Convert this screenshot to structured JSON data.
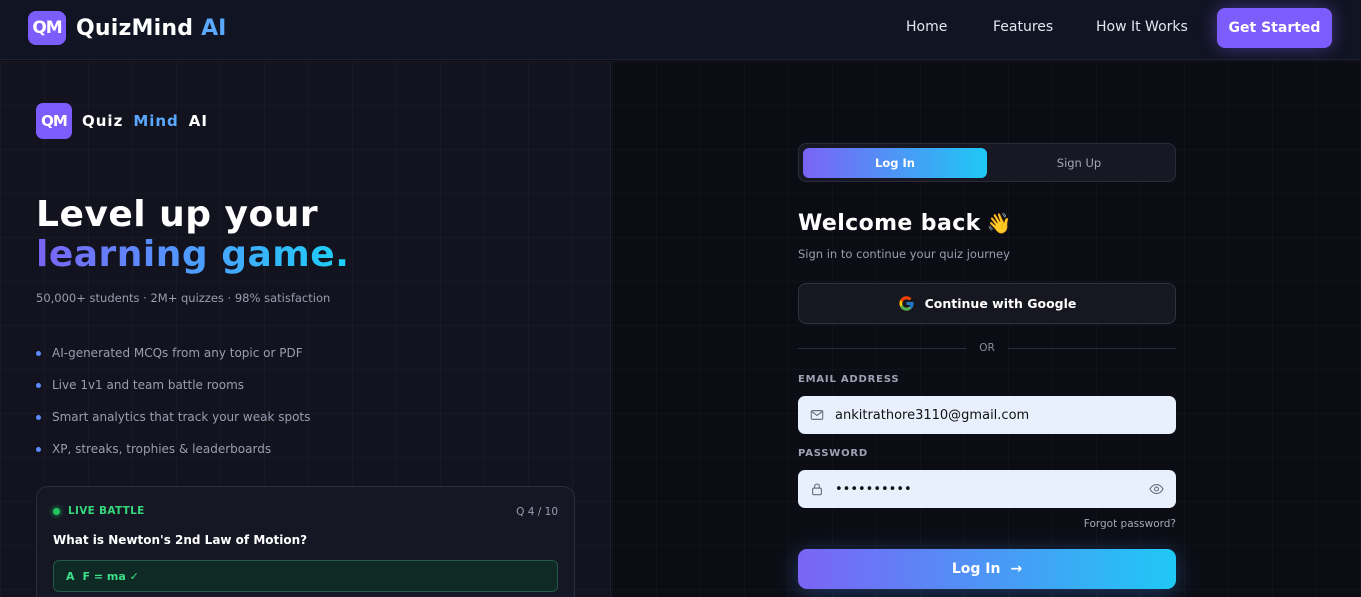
{
  "nav": {
    "logo_mark": "QM",
    "brand_name": "QuizMind",
    "brand_ai": "AI",
    "links": [
      "Home",
      "Features",
      "How It Works"
    ],
    "cta_label": "Get Started"
  },
  "left": {
    "logo_mark": "QM",
    "brand_quiz": "Quiz",
    "brand_mind": "Mind",
    "brand_ai": "AI",
    "hero_line1": "Level up your",
    "hero_line2": "learning game.",
    "stats": "50,000+ students · 2M+ quizzes · 98% satisfaction",
    "features": [
      "AI-generated MCQs from any topic or PDF",
      "Live 1v1 and team battle rooms",
      "Smart analytics that track your weak spots",
      "XP, streaks, trophies & leaderboards"
    ],
    "battle": {
      "live_label": "LIVE BATTLE",
      "question_count": "Q 4 / 10",
      "question": "What is Newton's 2nd Law of Motion?",
      "answer_letter": "A",
      "answer_text": "F = ma ✓"
    }
  },
  "auth": {
    "tabs": [
      "Log In",
      "Sign Up"
    ],
    "active_tab": "Log In",
    "welcome": "Welcome back",
    "wave": "👋",
    "subtitle": "Sign in to continue your quiz journey",
    "google_label": "Continue with Google",
    "or_text": "OR",
    "email_label": "EMAIL ADDRESS",
    "email_value": "ankitrathore3110@gmail.com",
    "password_label": "PASSWORD",
    "password_value": "••••••••••",
    "forgot_label": "Forgot password?",
    "login_label": "Log In",
    "login_arrow": "→"
  },
  "colors": {
    "accent_purple": "#7c5cfa",
    "accent_cyan": "#1fc8f5",
    "accent_blue": "#5aa9ff",
    "live_green": "#22c55e",
    "background": "#0d0e17"
  },
  "icons": [
    "google-icon",
    "mail-icon",
    "lock-icon",
    "eye-icon",
    "arrow-right-icon",
    "waving-hand-icon"
  ]
}
